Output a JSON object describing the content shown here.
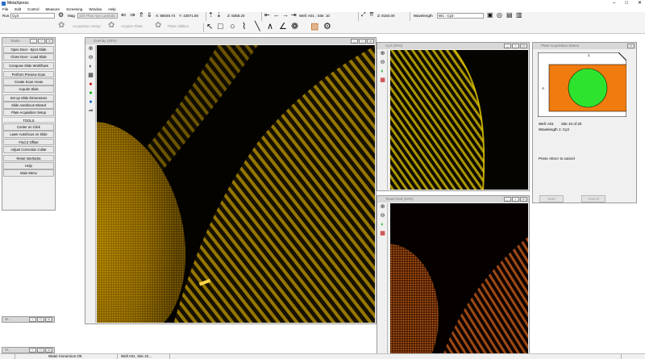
{
  "app": {
    "title": "MetaXpress"
  },
  "menu": [
    "File",
    "Edit",
    "Control",
    "Measure",
    "Screening",
    "Window",
    "Help"
  ],
  "toolbar": {
    "run_label": "Run:",
    "run_value": "Cy3",
    "mag_label": "Mag",
    "objective": "10X Plan Apo Lambda",
    "coord_x": "X: 88049.74",
    "coord_y": "Y: 42871.80",
    "coord_z": "Z: 8358.20",
    "well_site": "Well: A01 ; Site: 10",
    "z_value": "Z: 8184.00",
    "wavelength_label": "Wavelength",
    "wavelength_value": "W1 : Cy3",
    "acquisition_setup": "Acquisition Setup",
    "acquire_plate": "Acquire Plate",
    "plate_utilities": "Plate Utilities"
  },
  "task_panel": {
    "title": "Tasks",
    "buttons_top": [
      "Open Door - Eject Slide",
      "Close Door - Load Slide",
      "Compose Slide Workflows",
      "Perform Preview Scan",
      "Create Scan Areas",
      "Acquire Slide",
      "Set up Slide Dimensions",
      "Slide Autofocus Wizard",
      "Plate Acquisition Setup"
    ],
    "tools_heading": "TOOLS",
    "buttons_bottom": [
      "Center on Click",
      "Laser Autofocus on Slide",
      "Find Z Offset",
      "Adjust Correction Collar",
      "Reset Interlocks",
      "Help",
      "Main Menu"
    ]
  },
  "windows": {
    "overlay": {
      "title": "Overlay (40%)"
    },
    "cy3": {
      "title": "Cy3 (20%)"
    },
    "texas_red": {
      "title": "Texas Red (20%)"
    },
    "plate_status": {
      "title": "Plate Acquisition Status",
      "column_label": "1",
      "row_label": "A",
      "well_line": "Well: A01",
      "site_line": "Site 10 of 20",
      "wavelength_line": "Wavelength 1: Cy3",
      "press_line": "Press <Esc> to cancel",
      "start_button": "Start",
      "cancel_button": "Cancel"
    }
  },
  "minimized": [
    {
      "label": "W..."
    },
    {
      "label": "W..."
    }
  ],
  "statusbar": {
    "field1": "Water Immersion OK",
    "field2": "Well A01, Site 10..."
  },
  "colors": {
    "plate_orange": "#f07c10",
    "well_green": "#2ee32e",
    "overlay_signal": "#c9a300",
    "cy3_signal": "#c8b000",
    "texas_red_signal": "#b8561a"
  }
}
